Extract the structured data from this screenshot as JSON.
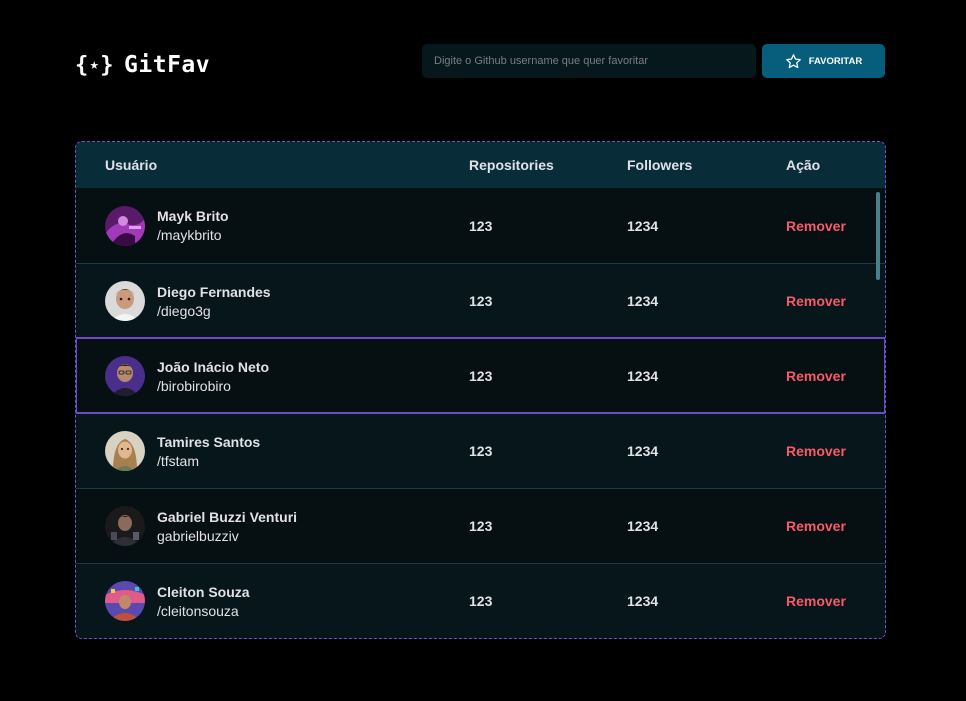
{
  "app": {
    "logo_brace_open": "{",
    "logo_star": "★",
    "logo_brace_close": "}",
    "logo_text": "GitFav"
  },
  "search": {
    "placeholder": "Digite o Github username que quer favoritar",
    "value": ""
  },
  "favorite_button": {
    "label": "FAVORITAR",
    "icon": "star-outline-icon"
  },
  "table": {
    "headers": {
      "user": "Usuário",
      "repositories": "Repositories",
      "followers": "Followers",
      "action": "Ação"
    },
    "rows": [
      {
        "name": "Mayk Brito",
        "login": "/maykbrito",
        "repositories": "123",
        "followers": "1234",
        "action": "Remover",
        "avatar_color": "#6A2A7A"
      },
      {
        "name": "Diego Fernandes",
        "login": "/diego3g",
        "repositories": "123",
        "followers": "1234",
        "action": "Remover",
        "avatar_color": "#8A6A5A"
      },
      {
        "name": "João Inácio Neto",
        "login": "/birobirobiro",
        "repositories": "123",
        "followers": "1234",
        "action": "Remover",
        "avatar_color": "#4B3A8C"
      },
      {
        "name": "Tamires Santos",
        "login": "/tfstam",
        "repositories": "123",
        "followers": "1234",
        "action": "Remover",
        "avatar_color": "#B59A6A"
      },
      {
        "name": "Gabriel Buzzi Venturi",
        "login": "gabrielbuzziv",
        "repositories": "123",
        "followers": "1234",
        "action": "Remover",
        "avatar_color": "#3A3A3A"
      },
      {
        "name": "Cleiton Souza",
        "login": "/cleitonsouza",
        "repositories": "123",
        "followers": "1234",
        "action": "Remover",
        "avatar_color": "#5A4AA0"
      }
    ]
  },
  "colors": {
    "background": "#000000",
    "header_row": "#092D38",
    "row_dark": "#060F12",
    "row_light": "#06161B",
    "button": "#065E7C",
    "remove": "#F75A68",
    "selection_border": "#6E49C8"
  }
}
